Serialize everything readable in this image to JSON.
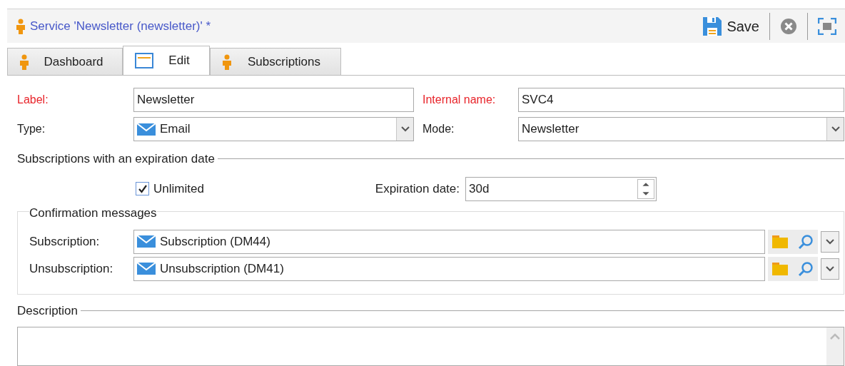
{
  "window": {
    "title": "Service 'Newsletter (newsletter)' *"
  },
  "toolbar": {
    "save": "Save"
  },
  "tabs": [
    {
      "label": "Dashboard",
      "selected": false,
      "kind": "person"
    },
    {
      "label": "Edit",
      "selected": true,
      "kind": "form"
    },
    {
      "label": "Subscriptions",
      "selected": false,
      "kind": "person"
    }
  ],
  "fields": [
    {
      "label": "Label:",
      "value": "Newsletter",
      "required": true,
      "kind": "text"
    },
    {
      "label": "Internal name:",
      "value": "SVC4",
      "required": true,
      "kind": "text"
    },
    {
      "label": "Type:",
      "value": "Email",
      "required": false,
      "kind": "mailselect"
    },
    {
      "label": "Mode:",
      "value": "Newsletter",
      "required": false,
      "kind": "select"
    }
  ],
  "expiration": {
    "title": "Subscriptions with an expiration date",
    "unlimited": {
      "label": "Unlimited",
      "checked": true
    },
    "date_label": "Expiration date:",
    "date_value": "30d"
  },
  "confirmation": {
    "title": "Confirmation messages",
    "rows": [
      {
        "label": "Subscription:",
        "value": "Subscription (DM44)"
      },
      {
        "label": "Unsubscription:",
        "value": "Unsubscription (DM41)"
      }
    ]
  },
  "description": {
    "title": "Description"
  }
}
